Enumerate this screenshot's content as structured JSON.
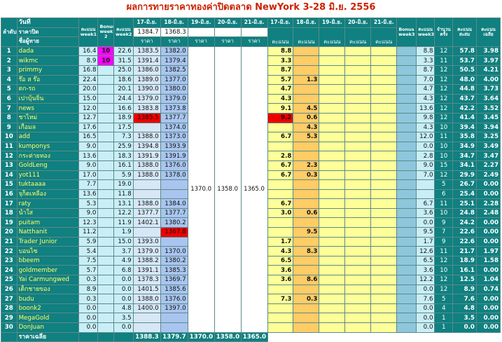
{
  "title": "ผลการทายราคาทองค่าปิดตลาด NewYork 3-28 มิ.ย. 2556",
  "header": {
    "rank": "ลำดับ",
    "day": "วันที่",
    "close": "ราคาปิด",
    "player": "ชื่อผู้ทาย",
    "week1": "คะแนน week1",
    "bonus": "Bonus week 2",
    "week2": "คะแนน week2",
    "d17": "17-มิ.ย.",
    "d18": "18-มิ.ย.",
    "d19": "19-มิ.ย.",
    "d20": "20-มิ.ย.",
    "d21": "21-มิ.ย.",
    "price": "ราคา",
    "score": "คะแนน",
    "bonus3": "Bonus week3",
    "week3": "คะแนน week3",
    "count": "จำนวน ครั้ง",
    "total": "คะแนน สะสม",
    "avg": "คะแนน เฉลี่ย",
    "close17": "1384.7",
    "close18": "1368.3"
  },
  "shared_prices": {
    "d19": "1370.0",
    "d20": "1358.0",
    "d21": "1365.0"
  },
  "rows": [
    {
      "rank": "1",
      "name": "dada",
      "w1": "16.4",
      "bonus": "10",
      "w2": "22.6",
      "p17": "1383.5",
      "p18": "1382.0",
      "s17": "8.8",
      "s18": "",
      "w3": "8.8",
      "cnt": "12",
      "tot": "57.8",
      "avg": "3.98"
    },
    {
      "rank": "2",
      "name": "wikmc",
      "w1": "8.9",
      "bonus": "10",
      "w2": "31.5",
      "p17": "1391.4",
      "p18": "1379.4",
      "s17": "3.3",
      "s18": "",
      "w3": "3.3",
      "cnt": "11",
      "tot": "53.7",
      "avg": "3.97"
    },
    {
      "rank": "3",
      "name": "primmy",
      "w1": "16.8",
      "bonus": "",
      "w2": "25.0",
      "p17": "1386.0",
      "p18": "1382.5",
      "s17": "8.7",
      "s18": "",
      "w3": "8.7",
      "cnt": "12",
      "tot": "50.5",
      "avg": "4.21"
    },
    {
      "rank": "4",
      "name": "ร๊อ ส ร๊อ",
      "w1": "22.4",
      "bonus": "",
      "w2": "18.6",
      "p17": "1389.0",
      "p18": "1377.0",
      "s17": "5.7",
      "s18": "1.3",
      "w3": "7.0",
      "cnt": "12",
      "tot": "48.0",
      "avg": "4.00"
    },
    {
      "rank": "5",
      "name": "ดก-รถ",
      "w1": "20.0",
      "bonus": "",
      "w2": "20.1",
      "p17": "1390.0",
      "p18": "1380.0",
      "s17": "4.7",
      "s18": "",
      "w3": "4.7",
      "cnt": "12",
      "tot": "44.8",
      "avg": "3.73"
    },
    {
      "rank": "6",
      "name": "เปาบุ้นจิ้น",
      "w1": "15.0",
      "bonus": "",
      "w2": "24.4",
      "p17": "1379.0",
      "p18": "1379.0",
      "s17": "4.3",
      "s18": "",
      "w3": "4.3",
      "cnt": "12",
      "tot": "43.7",
      "avg": "3.64"
    },
    {
      "rank": "7",
      "name": "news",
      "w1": "12.0",
      "bonus": "",
      "w2": "16.6",
      "p17": "1383.8",
      "p18": "1373.8",
      "s17": "9.1",
      "s18": "4.5",
      "w3": "13.6",
      "cnt": "12",
      "tot": "42.2",
      "avg": "3.52"
    },
    {
      "rank": "8",
      "name": "ชาไหม่",
      "w1": "12.7",
      "bonus": "",
      "w2": "18.9",
      "p17": "1385.5",
      "p18": "1377.7",
      "s17": "9.2",
      "s18": "0.6",
      "w3": "9.8",
      "cnt": "12",
      "tot": "41.4",
      "avg": "3.45",
      "red": true
    },
    {
      "rank": "9",
      "name": "เกื้อมล",
      "w1": "17.6",
      "bonus": "",
      "w2": "17.5",
      "p17": "",
      "p18": "1374.0",
      "s17": "",
      "s18": "4.3",
      "w3": "4.3",
      "cnt": "10",
      "tot": "39.4",
      "avg": "3.94"
    },
    {
      "rank": "10",
      "name": "add",
      "w1": "16.5",
      "bonus": "",
      "w2": "7.3",
      "p17": "1388.0",
      "p18": "1373.0",
      "s17": "6.7",
      "s18": "5.3",
      "w3": "12.0",
      "cnt": "11",
      "tot": "35.8",
      "avg": "3.25"
    },
    {
      "rank": "11",
      "name": "kumponys",
      "w1": "9.0",
      "bonus": "",
      "w2": "25.9",
      "p17": "1394.8",
      "p18": "1393.9",
      "s17": "",
      "s18": "",
      "w3": "0.0",
      "cnt": "10",
      "tot": "34.9",
      "avg": "3.49"
    },
    {
      "rank": "12",
      "name": "กระต่ายทอง",
      "w1": "13.6",
      "bonus": "",
      "w2": "18.3",
      "p17": "1391.9",
      "p18": "1391.9",
      "s17": "2.8",
      "s18": "",
      "w3": "2.8",
      "cnt": "10",
      "tot": "34.7",
      "avg": "3.47"
    },
    {
      "rank": "13",
      "name": "GoldLeng",
      "w1": "9.0",
      "bonus": "",
      "w2": "16.1",
      "p17": "1388.0",
      "p18": "1376.0",
      "s17": "6.7",
      "s18": "2.3",
      "w3": "9.0",
      "cnt": "15",
      "tot": "34.1",
      "avg": "2.27"
    },
    {
      "rank": "14",
      "name": "yot111",
      "w1": "17.0",
      "bonus": "",
      "w2": "5.9",
      "p17": "1388.0",
      "p18": "1378.0",
      "s17": "6.7",
      "s18": "0.3",
      "w3": "7.0",
      "cnt": "12",
      "tot": "29.9",
      "avg": "2.49"
    },
    {
      "rank": "15",
      "name": "tuktaaaa",
      "w1": "7.7",
      "bonus": "",
      "w2": "19.0",
      "p17": "",
      "p18": "",
      "s17": "",
      "s18": "",
      "w3": "",
      "cnt": "5",
      "tot": "26.7",
      "avg": "0.00"
    },
    {
      "rank": "16",
      "name": "จุก็ดเหลือง",
      "w1": "13.6",
      "bonus": "",
      "w2": "11.8",
      "p17": "",
      "p18": "",
      "s17": "",
      "s18": "",
      "w3": "",
      "cnt": "6",
      "tot": "25.4",
      "avg": "0.00"
    },
    {
      "rank": "17",
      "name": "raty",
      "w1": "5.3",
      "bonus": "",
      "w2": "13.1",
      "p17": "1388.0",
      "p18": "1384.0",
      "s17": "6.7",
      "s18": "",
      "w3": "6.7",
      "cnt": "11",
      "tot": "25.1",
      "avg": "2.28"
    },
    {
      "rank": "18",
      "name": "น้ำใส",
      "w1": "9.0",
      "bonus": "",
      "w2": "12.2",
      "p17": "1377.7",
      "p18": "1377.7",
      "s17": "3.0",
      "s18": "0.6",
      "w3": "3.6",
      "cnt": "10",
      "tot": "24.8",
      "avg": "2.48"
    },
    {
      "rank": "19",
      "name": "puitam",
      "w1": "12.3",
      "bonus": "",
      "w2": "11.9",
      "p17": "1402.1",
      "p18": "1380.2",
      "s17": "",
      "s18": "",
      "w3": "0.0",
      "cnt": "9",
      "tot": "24.2",
      "avg": "0.00"
    },
    {
      "rank": "20",
      "name": "Natthanit",
      "w1": "11.2",
      "bonus": "",
      "w2": "1.9",
      "p17": "",
      "p18": "1367.8",
      "s17": "",
      "s18": "9.5",
      "w3": "9.5",
      "cnt": "7",
      "tot": "22.6",
      "avg": "0.00",
      "red18": true
    },
    {
      "rank": "21",
      "name": "Trader Junior",
      "w1": "5.9",
      "bonus": "",
      "w2": "15.0",
      "p17": "1393.0",
      "p18": "",
      "s17": "1.7",
      "s18": "",
      "w3": "1.7",
      "cnt": "9",
      "tot": "22.6",
      "avg": "0.00"
    },
    {
      "rank": "22",
      "name": "บอนไซ",
      "w1": "5.4",
      "bonus": "",
      "w2": "3.7",
      "p17": "1379.0",
      "p18": "1370.0",
      "s17": "4.3",
      "s18": "8.3",
      "w3": "12.6",
      "cnt": "11",
      "tot": "21.7",
      "avg": "1.97"
    },
    {
      "rank": "23",
      "name": "bbeem",
      "w1": "7.5",
      "bonus": "",
      "w2": "4.9",
      "p17": "1388.2",
      "p18": "1380.2",
      "s17": "6.5",
      "s18": "",
      "w3": "6.5",
      "cnt": "12",
      "tot": "18.9",
      "avg": "1.58"
    },
    {
      "rank": "24",
      "name": "goldmember",
      "w1": "5.7",
      "bonus": "",
      "w2": "6.8",
      "p17": "1391.1",
      "p18": "1385.3",
      "s17": "3.6",
      "s18": "",
      "w3": "3.6",
      "cnt": "10",
      "tot": "16.1",
      "avg": "0.00"
    },
    {
      "rank": "25",
      "name": "Yai Carmungwed",
      "w1": "0.3",
      "bonus": "",
      "w2": "0.0",
      "p17": "1378.3",
      "p18": "1369.7",
      "s17": "3.6",
      "s18": "8.6",
      "w3": "12.2",
      "cnt": "12",
      "tot": "12.5",
      "avg": "1.04"
    },
    {
      "rank": "26",
      "name": "เด็กชายของ",
      "w1": "8.9",
      "bonus": "",
      "w2": "0.0",
      "p17": "1401.5",
      "p18": "1385.6",
      "s17": "",
      "s18": "",
      "w3": "0.0",
      "cnt": "12",
      "tot": "8.9",
      "avg": "0.74"
    },
    {
      "rank": "27",
      "name": "budu",
      "w1": "0.3",
      "bonus": "",
      "w2": "0.0",
      "p17": "1388.0",
      "p18": "1376.0",
      "s17": "7.3",
      "s18": "0.3",
      "w3": "7.6",
      "cnt": "5",
      "tot": "7.6",
      "avg": "0.00"
    },
    {
      "rank": "28",
      "name": "boonk2",
      "w1": "0.0",
      "bonus": "",
      "w2": "4.8",
      "p17": "1400.0",
      "p18": "1397.0",
      "s17": "",
      "s18": "",
      "w3": "0.0",
      "cnt": "4",
      "tot": "4.8",
      "avg": "0.00"
    },
    {
      "rank": "29",
      "name": "MegaGold",
      "w1": "0.0",
      "bonus": "",
      "w2": "3.5",
      "p17": "",
      "p18": "",
      "s17": "",
      "s18": "",
      "w3": "0.0",
      "cnt": "1",
      "tot": "3.5",
      "avg": "0.00"
    },
    {
      "rank": "30",
      "name": "DonJuan",
      "w1": "0.0",
      "bonus": "",
      "w2": "0.0",
      "p17": "",
      "p18": "",
      "s17": "",
      "s18": "",
      "w3": "0.0",
      "cnt": "1",
      "tot": "0.0",
      "avg": "0.00"
    }
  ],
  "footer": {
    "label": "ราคาเฉลี่ย",
    "p17": "1388.3",
    "p18": "1379.7",
    "p19": "1370.0",
    "p20": "1358.0",
    "p21": "1365.0"
  }
}
